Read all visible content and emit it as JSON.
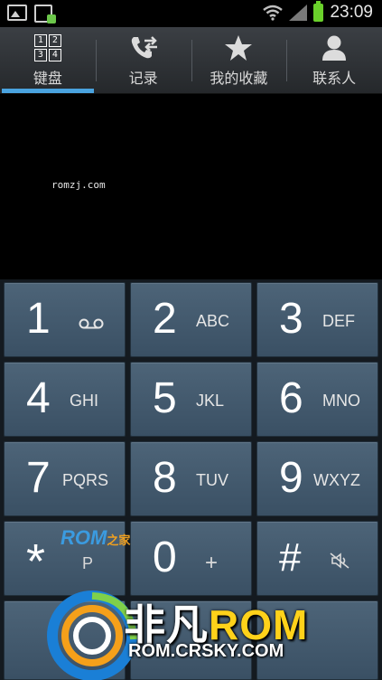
{
  "status_bar": {
    "time": "23:09",
    "icons": [
      "image-notification-icon",
      "usb-notification-icon",
      "wifi-icon",
      "signal-icon",
      "battery-icon"
    ]
  },
  "tabs": [
    {
      "label": "键盘",
      "icon": "keypad-icon",
      "active": true
    },
    {
      "label": "记录",
      "icon": "call-log-icon",
      "active": false
    },
    {
      "label": "我的收藏",
      "icon": "star-icon",
      "active": false
    },
    {
      "label": "联系人",
      "icon": "person-icon",
      "active": false
    }
  ],
  "grid_icon_digits": [
    "1",
    "2",
    "3",
    "4"
  ],
  "display": {
    "watermark": "romzj.com"
  },
  "keys": [
    {
      "digit": "1",
      "letters": "",
      "icon": "voicemail-icon"
    },
    {
      "digit": "2",
      "letters": "ABC"
    },
    {
      "digit": "3",
      "letters": "DEF"
    },
    {
      "digit": "4",
      "letters": "GHI"
    },
    {
      "digit": "5",
      "letters": "JKL"
    },
    {
      "digit": "6",
      "letters": "MNO"
    },
    {
      "digit": "7",
      "letters": "PQRS"
    },
    {
      "digit": "8",
      "letters": "TUV"
    },
    {
      "digit": "9",
      "letters": "WXYZ"
    },
    {
      "digit": "*",
      "letters": "P"
    },
    {
      "digit": "0",
      "letters": "+"
    },
    {
      "digit": "#",
      "letters": "",
      "icon": "mute-icon"
    }
  ],
  "watermarks": {
    "rom_zhijia_rom": "ROM",
    "rom_zhijia_cn": "之家",
    "crsky_title_cn": "非凡",
    "crsky_title_rom": "ROM",
    "crsky_url": "ROM.CRSKY.COM"
  },
  "colors": {
    "active_tab_underline": "#4aa3df",
    "key_face": "#4d6478",
    "battery": "#6ad12b"
  }
}
